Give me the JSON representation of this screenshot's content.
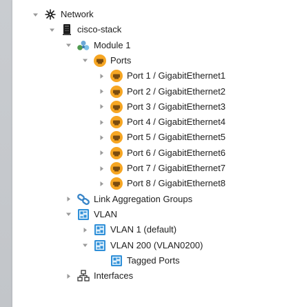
{
  "tree": [
    {
      "label": "Network",
      "icon": "network-globe-icon",
      "expanded": true,
      "level": 0
    },
    {
      "label": "cisco-stack",
      "icon": "switch-device-icon",
      "expanded": true,
      "level": 1
    },
    {
      "label": "Module 1",
      "icon": "module-cluster-icon",
      "expanded": true,
      "level": 2
    },
    {
      "label": "Ports",
      "icon": "port-icon",
      "expanded": true,
      "level": 3
    },
    {
      "label": "Port 1 / GigabitEthernet1",
      "icon": "port-icon",
      "expanded": false,
      "level": 4
    },
    {
      "label": "Port 2 / GigabitEthernet2",
      "icon": "port-icon",
      "expanded": false,
      "level": 4
    },
    {
      "label": "Port 3 / GigabitEthernet3",
      "icon": "port-icon",
      "expanded": false,
      "level": 4
    },
    {
      "label": "Port 4 / GigabitEthernet4",
      "icon": "port-icon",
      "expanded": false,
      "level": 4
    },
    {
      "label": "Port 5 / GigabitEthernet5",
      "icon": "port-icon",
      "expanded": false,
      "level": 4
    },
    {
      "label": "Port 6 / GigabitEthernet6",
      "icon": "port-icon",
      "expanded": false,
      "level": 4
    },
    {
      "label": "Port 7 / GigabitEthernet7",
      "icon": "port-icon",
      "expanded": false,
      "level": 4
    },
    {
      "label": "Port 8 / GigabitEthernet8",
      "icon": "port-icon",
      "expanded": false,
      "level": 4
    },
    {
      "label": "Link Aggregation Groups",
      "icon": "link-chain-icon",
      "expanded": false,
      "level": 2
    },
    {
      "label": "VLAN",
      "icon": "vlan-icon",
      "expanded": true,
      "level": 2
    },
    {
      "label": "VLAN 1 (default)",
      "icon": "vlan-icon",
      "expanded": false,
      "level": 3
    },
    {
      "label": "VLAN 200 (VLAN0200)",
      "icon": "vlan-icon",
      "expanded": true,
      "level": 3
    },
    {
      "label": "Tagged Ports",
      "icon": "vlan-icon",
      "expanded": null,
      "level": 4
    },
    {
      "label": "Interfaces",
      "icon": "interfaces-hierarchy-icon",
      "expanded": false,
      "level": 2
    }
  ],
  "colors": {
    "toggle": "#9a9a9a",
    "port_orange": "#f6a623",
    "port_dark": "#7a4c10",
    "vlan_blue": "#2f8fd8",
    "link_blue": "#3a86c8"
  }
}
